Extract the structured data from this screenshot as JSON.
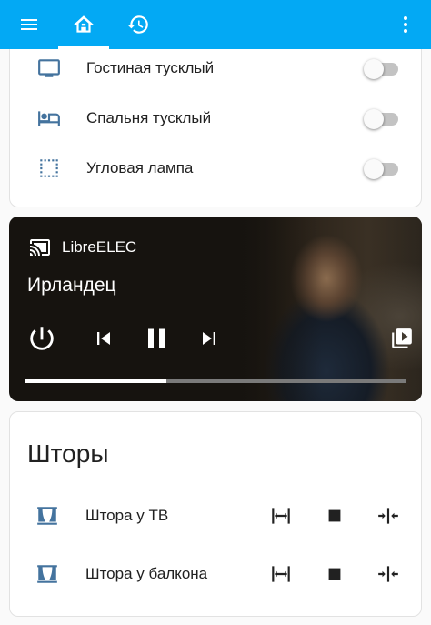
{
  "appbar": {
    "background_color": "#03a9f4",
    "menu_icon": "menu-icon",
    "home_icon": "home-icon",
    "history_icon": "history-icon",
    "more_icon": "more-vertical-icon"
  },
  "lights": {
    "items": [
      {
        "label": "Гостиная тусклый",
        "icon": "television-icon",
        "on": false
      },
      {
        "label": "Спальня тусклый",
        "icon": "bed-icon",
        "on": false
      },
      {
        "label": "Угловая лампа",
        "icon": "dashed-square-icon",
        "on": false
      }
    ]
  },
  "media": {
    "source": "LibreELEC",
    "title": "Ирландец",
    "progress": 0.37,
    "controls": [
      "power-icon",
      "skip-previous-icon",
      "pause-icon",
      "skip-next-icon"
    ],
    "source_icon": "cast-connected-icon",
    "select_icon": "playlist-select-icon"
  },
  "covers": {
    "title": "Шторы",
    "items": [
      {
        "label": "Штора у ТВ",
        "icon": "curtains-icon"
      },
      {
        "label": "Штора у балкона",
        "icon": "curtains-icon"
      }
    ],
    "buttons": [
      "curtain-open-icon",
      "stop-icon",
      "curtain-close-icon"
    ]
  },
  "colors": {
    "icon_accent": "#44739e",
    "toggle_off_track": "#bdbdbd"
  }
}
